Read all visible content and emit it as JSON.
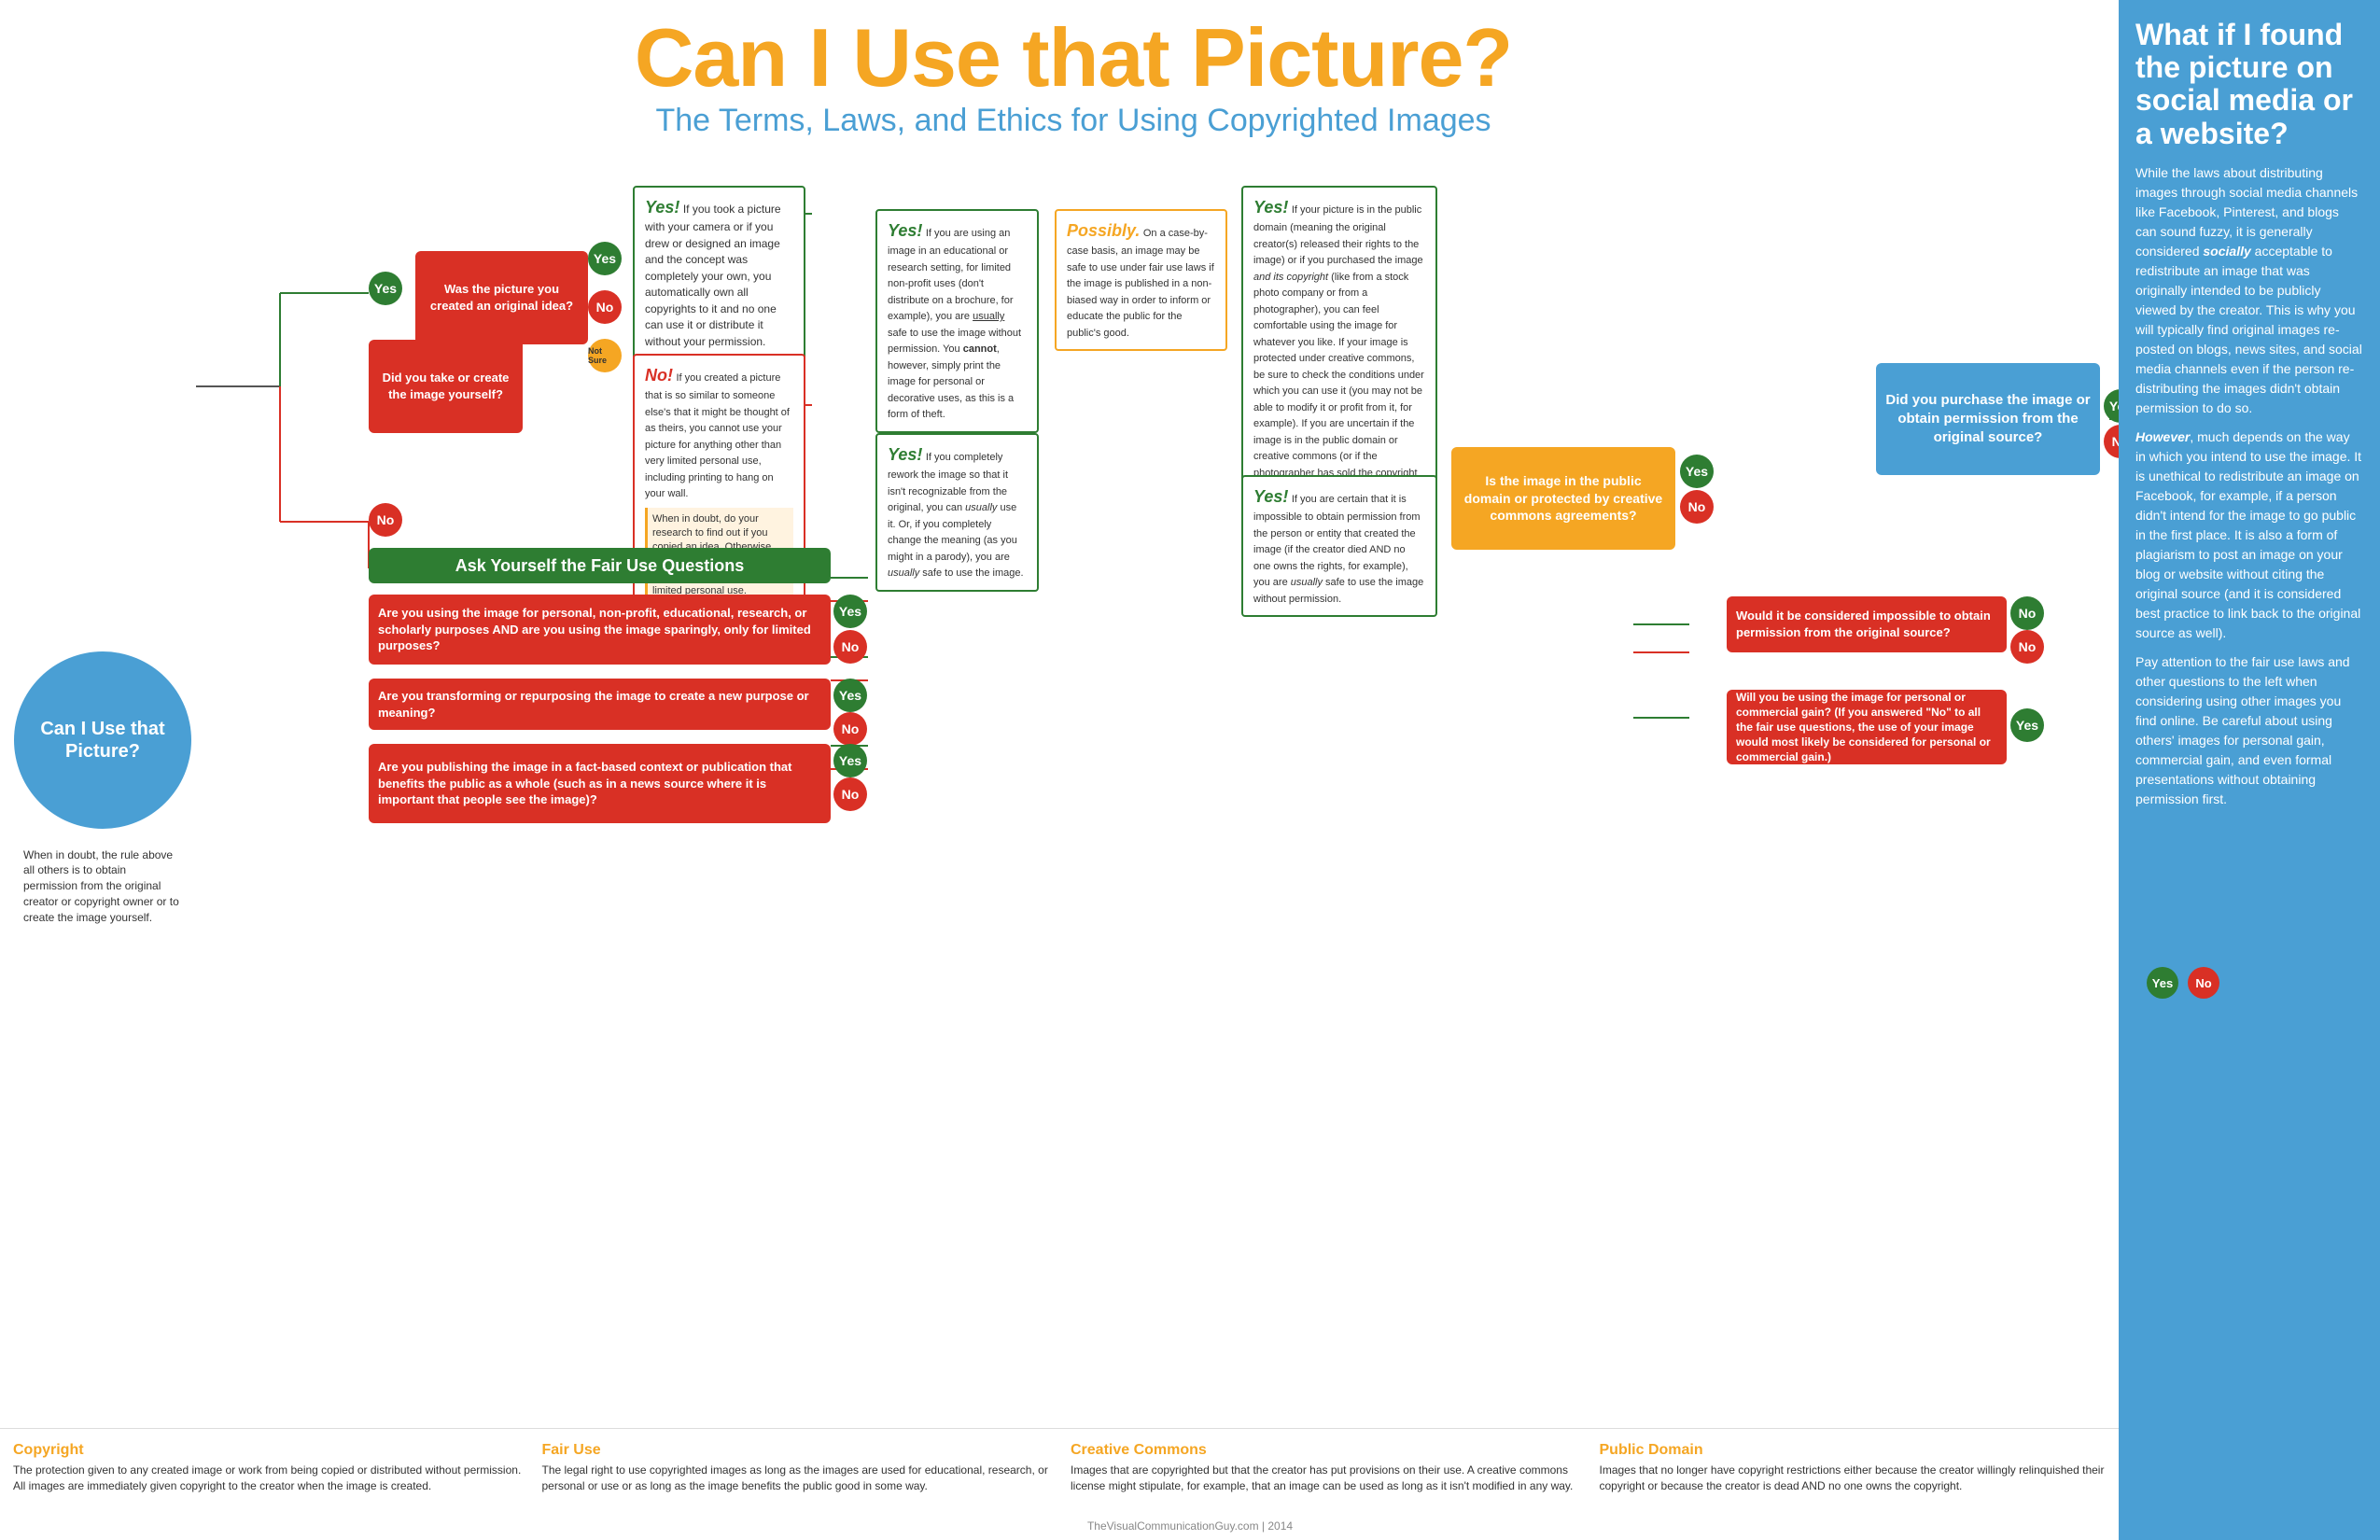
{
  "header": {
    "title": "Can I Use that Picture?",
    "subtitle": "The Terms, Laws, and Ethics for Using Copyrighted Images"
  },
  "sidebar": {
    "title": "What if I found the picture on social media or a website?",
    "paragraphs": [
      "While the laws about distributing images through social media channels like Facebook, Pinterest, and blogs can sound fuzzy, it is generally considered socially acceptable to redistribute an image that was originally intended to be publicly viewed by the creator. This is why you will typically find original images re-posted on blogs, news sites, and social media channels even if the person re-distributing the images didn't obtain permission to do so.",
      "However, much depends on the way in which you intend to use the image. It is unethical to redistribute an image on Facebook, for example, if a person didn't intend for the image to go public in the first place. It is also a form of plagiarism to post an image on your blog or website without citing the original source (and it is considered best practice to link back to the original source as well).",
      "Pay attention to the fair use laws and other questions to the left when considering using other images you find online. Be careful about using others' images for personal gain, commercial gain, and even formal presentations without obtaining permission first."
    ]
  },
  "left_panel": {
    "circle_text": "Can I Use that Picture?",
    "doubt_text": "When in doubt, the rule above all others is to obtain permission from the original creator or copyright owner or to create the image yourself."
  },
  "flowchart": {
    "entry_question": "Did you take or create the image yourself?",
    "yes_label": "Yes",
    "no_label": "No",
    "boxes": {
      "original_idea": {
        "question": "Was the picture you created an original idea?",
        "yes_circle": "Yes",
        "no_circle": "No",
        "not_sure": "Not Sure"
      },
      "yes_original": {
        "label": "Yes!",
        "text": "If you took a picture with your camera or if you drew or designed an image and the concept was completely your own, you automatically own all copyrights to it and no one can use it or distribute it without your permission."
      },
      "no_copied": {
        "label": "No!",
        "text": "If you created a picture that is so similar to someone else's that it might be thought of as theirs, you cannot use your picture for anything other than very limited personal use, including printing to hang on your wall.",
        "when_in_doubt": "When in doubt, do your research to find out if you copied an idea. Otherwise, don't use the picture for anything other than very limited personal use."
      },
      "educational_yes": {
        "label": "Yes!",
        "text": "If you are using an image in an educational or research setting, for limited non-profit uses (don't distribute on a brochure, for example), you are usually safe to use the image without permission. You cannot, however, simply print the image for personal or decorative uses, as this is a form of theft."
      },
      "reworked_yes1": {
        "label": "Yes!",
        "text": "If you completely rework the image so that it isn't recognizable from the original, you can usually use it."
      },
      "reworked_yes2": {
        "text": "Or, if you completely change the meaning (as you might in a parody), you are usually safe to use the image."
      },
      "possibly": {
        "label": "Possibly.",
        "text": "On a case-by-case basis, an image may be safe to use under fair use laws if the image is published in a non-biased way in order to inform or educate the public for the public's good."
      },
      "yes_public_domain": {
        "label": "Yes!",
        "text": "If your picture is in the public domain (meaning the original creator(s) released their rights to the image) or if you purchased the image and its copyright (like from a stock photo company or from a photographer), you can feel comfortable using the image for whatever you like. If your image is protected under creative commons, be sure to check the conditions under which you can use it (you may not be able to modify it or profit from it, for example). If you are uncertain if the image is in the public domain or creative commons (or if the photographer has sold the copyright to you), assume it is not and avoid using it until you've obtained permission."
      },
      "yes_certain": {
        "label": "Yes!",
        "text": "If you are certain that it is impossible to obtain permission from the person or entity that created the image (if the creator died AND no one owns the rights, for example), you are usually safe to use the image without permission."
      },
      "fair_use_title": "Ask Yourself the Fair Use Questions",
      "fair_use_q1": "Are you using the image for personal, non-profit, educational, research, or scholarly purposes AND are you using the image sparingly, only for limited purposes?",
      "fair_use_q2": "Are you transforming or repurposing the image to create a new purpose or meaning?",
      "fair_use_q3": "Are you publishing the image in a fact-based context or publication that benefits the public as a whole (such as in a news source where it is important that people see the image)?",
      "public_domain_q": "Is the image in the public domain or protected by creative commons agreements?",
      "impossible_q": "Would it be considered impossible to obtain permission from the original source?",
      "personal_gain_q": "Will you be using the image for personal or commercial gain? (If you answered \"No\" to all the fair use questions, the use of your image would most likely be considered for personal or commercial gain.)",
      "did_you_purchase": "Did you purchase the image or obtain permission from the original source?"
    }
  },
  "footer": {
    "sections": [
      {
        "title": "Copyright",
        "text": "The protection given to any created image or work from being copied or distributed without permission. All images are immediately given copyright to the creator when the image is created."
      },
      {
        "title": "Fair Use",
        "text": "The legal right to use copyrighted images as long as the images are used for educational, research, or personal or use or as long as the image benefits the public good in some way."
      },
      {
        "title": "Creative Commons",
        "text": "Images that are copyrighted but that the creator has put provisions on their use. A creative commons license might stipulate, for example, that an image can be used as long as it isn't modified in any way."
      },
      {
        "title": "Public Domain",
        "text": "Images that no longer have copyright restrictions either because the creator willingly relinquished their copyright or because the creator is dead AND no one owns the copyright."
      }
    ],
    "credit": "TheVisualCommunicationGuy.com | 2014"
  },
  "colors": {
    "green": "#2e7d32",
    "red": "#d93025",
    "orange": "#f5a623",
    "blue": "#4a9fd4",
    "lime": "#8bc34a",
    "white": "#ffffff",
    "dark": "#333333"
  }
}
